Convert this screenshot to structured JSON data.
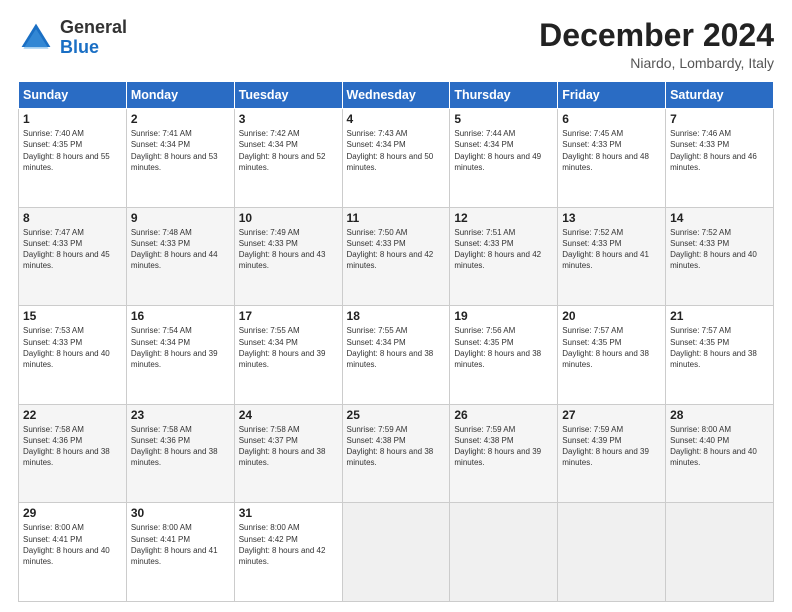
{
  "header": {
    "logo_general": "General",
    "logo_blue": "Blue",
    "month_title": "December 2024",
    "location": "Niardo, Lombardy, Italy"
  },
  "days_of_week": [
    "Sunday",
    "Monday",
    "Tuesday",
    "Wednesday",
    "Thursday",
    "Friday",
    "Saturday"
  ],
  "weeks": [
    [
      {
        "day": "1",
        "sunrise": "7:40 AM",
        "sunset": "4:35 PM",
        "daylight": "8 hours and 55 minutes."
      },
      {
        "day": "2",
        "sunrise": "7:41 AM",
        "sunset": "4:34 PM",
        "daylight": "8 hours and 53 minutes."
      },
      {
        "day": "3",
        "sunrise": "7:42 AM",
        "sunset": "4:34 PM",
        "daylight": "8 hours and 52 minutes."
      },
      {
        "day": "4",
        "sunrise": "7:43 AM",
        "sunset": "4:34 PM",
        "daylight": "8 hours and 50 minutes."
      },
      {
        "day": "5",
        "sunrise": "7:44 AM",
        "sunset": "4:34 PM",
        "daylight": "8 hours and 49 minutes."
      },
      {
        "day": "6",
        "sunrise": "7:45 AM",
        "sunset": "4:33 PM",
        "daylight": "8 hours and 48 minutes."
      },
      {
        "day": "7",
        "sunrise": "7:46 AM",
        "sunset": "4:33 PM",
        "daylight": "8 hours and 46 minutes."
      }
    ],
    [
      {
        "day": "8",
        "sunrise": "7:47 AM",
        "sunset": "4:33 PM",
        "daylight": "8 hours and 45 minutes."
      },
      {
        "day": "9",
        "sunrise": "7:48 AM",
        "sunset": "4:33 PM",
        "daylight": "8 hours and 44 minutes."
      },
      {
        "day": "10",
        "sunrise": "7:49 AM",
        "sunset": "4:33 PM",
        "daylight": "8 hours and 43 minutes."
      },
      {
        "day": "11",
        "sunrise": "7:50 AM",
        "sunset": "4:33 PM",
        "daylight": "8 hours and 42 minutes."
      },
      {
        "day": "12",
        "sunrise": "7:51 AM",
        "sunset": "4:33 PM",
        "daylight": "8 hours and 42 minutes."
      },
      {
        "day": "13",
        "sunrise": "7:52 AM",
        "sunset": "4:33 PM",
        "daylight": "8 hours and 41 minutes."
      },
      {
        "day": "14",
        "sunrise": "7:52 AM",
        "sunset": "4:33 PM",
        "daylight": "8 hours and 40 minutes."
      }
    ],
    [
      {
        "day": "15",
        "sunrise": "7:53 AM",
        "sunset": "4:33 PM",
        "daylight": "8 hours and 40 minutes."
      },
      {
        "day": "16",
        "sunrise": "7:54 AM",
        "sunset": "4:34 PM",
        "daylight": "8 hours and 39 minutes."
      },
      {
        "day": "17",
        "sunrise": "7:55 AM",
        "sunset": "4:34 PM",
        "daylight": "8 hours and 39 minutes."
      },
      {
        "day": "18",
        "sunrise": "7:55 AM",
        "sunset": "4:34 PM",
        "daylight": "8 hours and 38 minutes."
      },
      {
        "day": "19",
        "sunrise": "7:56 AM",
        "sunset": "4:35 PM",
        "daylight": "8 hours and 38 minutes."
      },
      {
        "day": "20",
        "sunrise": "7:57 AM",
        "sunset": "4:35 PM",
        "daylight": "8 hours and 38 minutes."
      },
      {
        "day": "21",
        "sunrise": "7:57 AM",
        "sunset": "4:35 PM",
        "daylight": "8 hours and 38 minutes."
      }
    ],
    [
      {
        "day": "22",
        "sunrise": "7:58 AM",
        "sunset": "4:36 PM",
        "daylight": "8 hours and 38 minutes."
      },
      {
        "day": "23",
        "sunrise": "7:58 AM",
        "sunset": "4:36 PM",
        "daylight": "8 hours and 38 minutes."
      },
      {
        "day": "24",
        "sunrise": "7:58 AM",
        "sunset": "4:37 PM",
        "daylight": "8 hours and 38 minutes."
      },
      {
        "day": "25",
        "sunrise": "7:59 AM",
        "sunset": "4:38 PM",
        "daylight": "8 hours and 38 minutes."
      },
      {
        "day": "26",
        "sunrise": "7:59 AM",
        "sunset": "4:38 PM",
        "daylight": "8 hours and 39 minutes."
      },
      {
        "day": "27",
        "sunrise": "7:59 AM",
        "sunset": "4:39 PM",
        "daylight": "8 hours and 39 minutes."
      },
      {
        "day": "28",
        "sunrise": "8:00 AM",
        "sunset": "4:40 PM",
        "daylight": "8 hours and 40 minutes."
      }
    ],
    [
      {
        "day": "29",
        "sunrise": "8:00 AM",
        "sunset": "4:41 PM",
        "daylight": "8 hours and 40 minutes."
      },
      {
        "day": "30",
        "sunrise": "8:00 AM",
        "sunset": "4:41 PM",
        "daylight": "8 hours and 41 minutes."
      },
      {
        "day": "31",
        "sunrise": "8:00 AM",
        "sunset": "4:42 PM",
        "daylight": "8 hours and 42 minutes."
      },
      null,
      null,
      null,
      null
    ]
  ]
}
